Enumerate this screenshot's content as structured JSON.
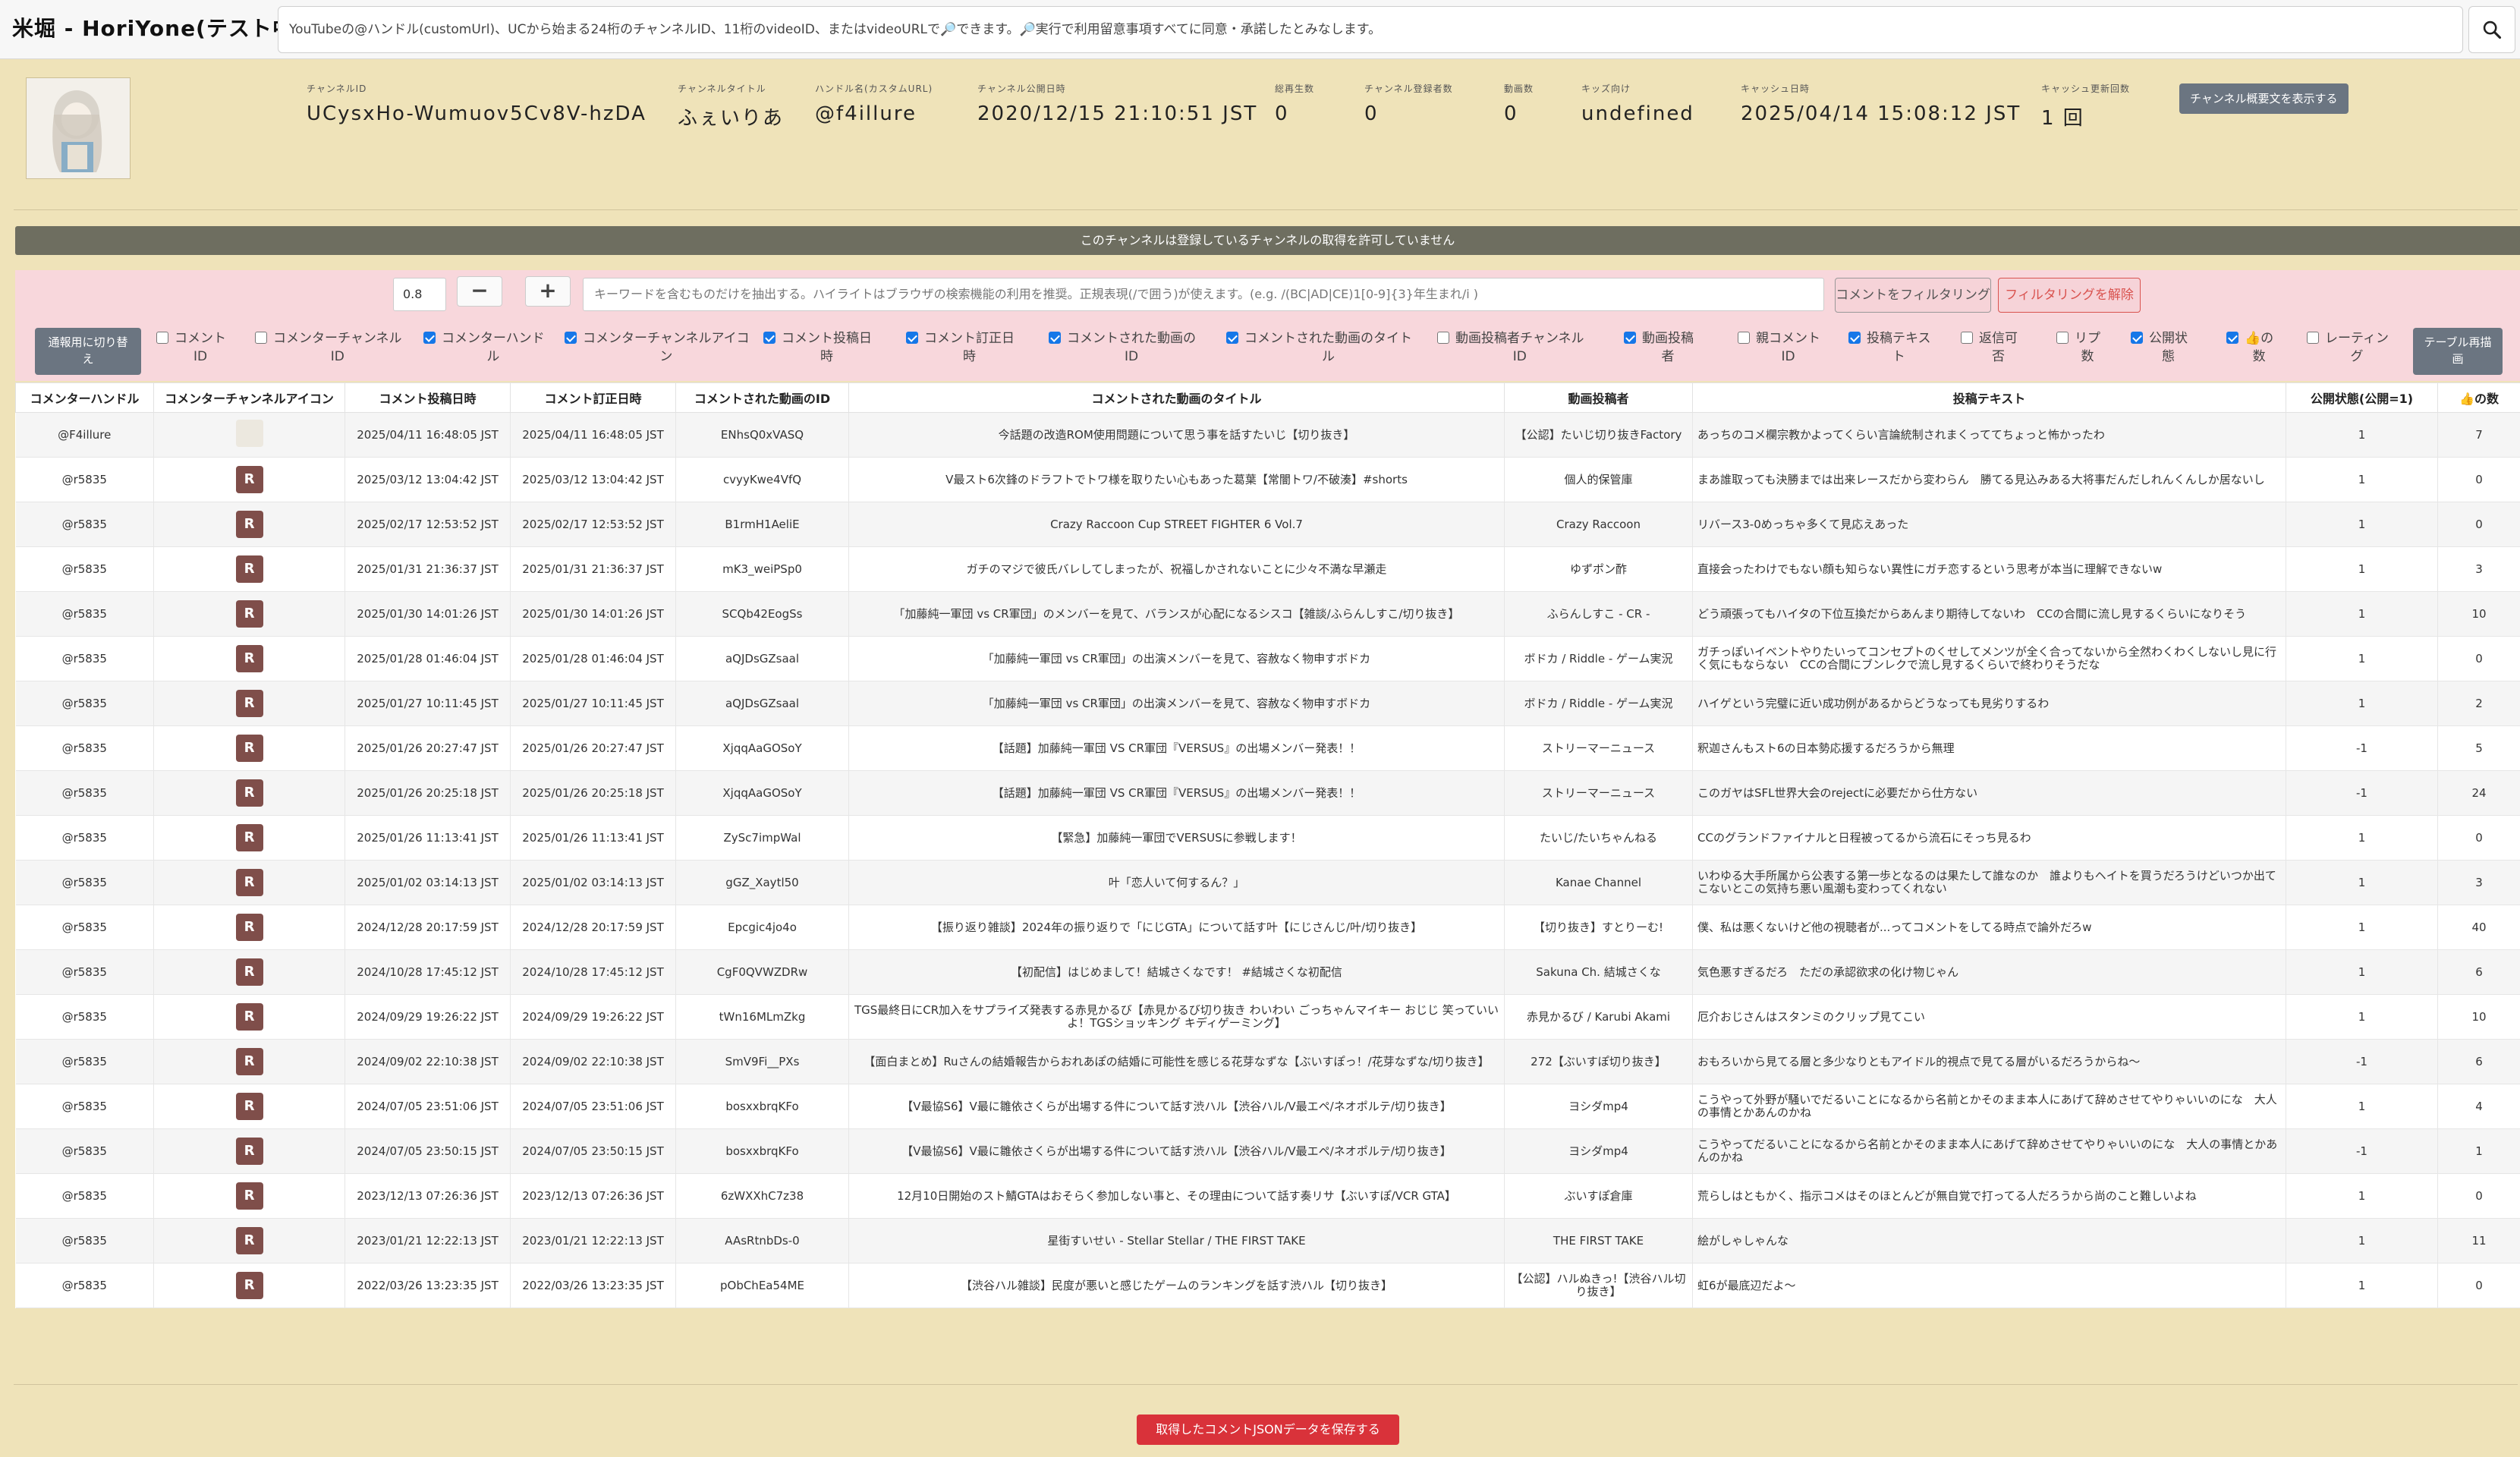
{
  "app_title": "米堀 - HoriYone(テスト中)",
  "search": {
    "placeholder": "YouTubeの@ハンドル(customUrl)、UCから始まる24桁のチャンネルID、11桁のvideoID、またはvideoURLで🔎できます。🔎実行で利用留意事項すべてに同意・承諾したとみなします。"
  },
  "channel": {
    "fields": [
      {
        "label": "チャンネルID",
        "value": "UCysxHo-Wumuov5Cv8V-hzDA"
      },
      {
        "label": "チャンネルタイトル",
        "value": "ふぇいりあ"
      },
      {
        "label": "ハンドル名(カスタムURL)",
        "value": "@f4illure"
      },
      {
        "label": "チャンネル公開日時",
        "value": "2020/12/15 21:10:51 JST"
      },
      {
        "label": "総再生数",
        "value": "0"
      },
      {
        "label": "チャンネル登録者数",
        "value": "0"
      },
      {
        "label": "動画数",
        "value": "0"
      },
      {
        "label": "キッズ向け",
        "value": "undefined"
      },
      {
        "label": "キャッシュ日時",
        "value": "2025/04/14 15:08:12 JST"
      },
      {
        "label": "キャッシュ更新回数",
        "value": "1 回"
      }
    ],
    "desc_button": "チャンネル概要文を表示する"
  },
  "notice": "このチャンネルは登録しているチャンネルの取得を許可していません",
  "filter": {
    "threshold": "0.8",
    "minus": "−",
    "plus": "+",
    "keyword_placeholder": "キーワードを含むものだけを抽出する。ハイライトはブラウザの検索機能の利用を推奨。正規表現(/で囲う)が使えます。(e.g. /(BC|AD|CE)1[0-9]{3}年生まれ/i )",
    "filter_button": "コメントをフィルタリング",
    "clear_button": "フィルタリングを解除",
    "toggle_view_line1": "通報用に切り替",
    "toggle_view_line2": "え",
    "redraw_line1": "テーブル再描",
    "redraw_line2": "画"
  },
  "column_toggles": [
    {
      "l1": "コメント",
      "l2": "ID",
      "checked": false
    },
    {
      "l1": "コメンターチャンネル",
      "l2": "ID",
      "checked": false
    },
    {
      "l1": "コメンターハンド",
      "l2": "ル",
      "checked": true
    },
    {
      "l1": "コメンターチャンネルアイコ",
      "l2": "ン",
      "checked": true
    },
    {
      "l1": "コメント投稿日",
      "l2": "時",
      "checked": true
    },
    {
      "l1": "コメント訂正日",
      "l2": "時",
      "checked": true
    },
    {
      "l1": "コメントされた動画の",
      "l2": "ID",
      "checked": true
    },
    {
      "l1": "コメントされた動画のタイト",
      "l2": "ル",
      "checked": true
    },
    {
      "l1": "動画投稿者チャンネル",
      "l2": "ID",
      "checked": false
    },
    {
      "l1": "動画投稿",
      "l2": "者",
      "checked": true
    },
    {
      "l1": "親コメント",
      "l2": "ID",
      "checked": false
    },
    {
      "l1": "投稿テキス",
      "l2": "ト",
      "checked": true
    },
    {
      "l1": "返信可",
      "l2": "否",
      "checked": false
    },
    {
      "l1": "リプ",
      "l2": "数",
      "checked": false
    },
    {
      "l1": "公開状",
      "l2": "態",
      "checked": true
    },
    {
      "l1": "👍の",
      "l2": "数",
      "checked": true
    },
    {
      "l1": "レーティン",
      "l2": "グ",
      "checked": false
    }
  ],
  "table": {
    "headers": [
      "コメンターハンドル",
      "コメンターチャンネルアイコン",
      "コメント投稿日時",
      "コメント訂正日時",
      "コメントされた動画のID",
      "コメントされた動画のタイトル",
      "動画投稿者",
      "投稿テキスト",
      "公開状態(公開=1)",
      "👍の数"
    ],
    "rows": [
      {
        "handle": "@F4illure",
        "icon": "img",
        "posted": "2025/04/11 16:48:05 JST",
        "edited": "2025/04/11 16:48:05 JST",
        "video_id": "ENhsQ0xVASQ",
        "title": "今話題の改造ROM使用問題について思う事を話すたいじ【切り抜き】",
        "uploader": "【公認】たいじ切り抜きFactory",
        "text": "あっちのコメ欄宗教かよってくらい言論統制されまくっててちょっと怖かったわ",
        "status": "1",
        "likes": "7"
      },
      {
        "handle": "@r5835",
        "icon": "R",
        "posted": "2025/03/12 13:04:42 JST",
        "edited": "2025/03/12 13:04:42 JST",
        "video_id": "cvyyKwe4VfQ",
        "title": "V最スト6次鋒のドラフトでトワ様を取りたい心もあった葛葉【常闇トワ/不破湊】#shorts",
        "uploader": "個人的保管庫",
        "text": "まあ誰取っても決勝までは出来レースだから変わらん　勝てる見込みある大将事だんだしれんくんしか居ないし",
        "status": "1",
        "likes": "0"
      },
      {
        "handle": "@r5835",
        "icon": "R",
        "posted": "2025/02/17 12:53:52 JST",
        "edited": "2025/02/17 12:53:52 JST",
        "video_id": "B1rmH1AeliE",
        "title": "Crazy Raccoon Cup STREET FIGHTER 6 Vol.7",
        "uploader": "Crazy Raccoon",
        "text": "リバース3-0めっちゃ多くて見応えあった",
        "status": "1",
        "likes": "0"
      },
      {
        "handle": "@r5835",
        "icon": "R",
        "posted": "2025/01/31 21:36:37 JST",
        "edited": "2025/01/31 21:36:37 JST",
        "video_id": "mK3_weiPSp0",
        "title": "ガチのマジで彼氏バレしてしまったが、祝福しかされないことに少々不満な早瀬走",
        "uploader": "ゆずポン酢",
        "text": "直接会ったわけでもない顔も知らない異性にガチ恋するという思考が本当に理解できないw",
        "status": "1",
        "likes": "3"
      },
      {
        "handle": "@r5835",
        "icon": "R",
        "posted": "2025/01/30 14:01:26 JST",
        "edited": "2025/01/30 14:01:26 JST",
        "video_id": "SCQb42EogSs",
        "title": "「加藤純一軍団 vs CR軍団」のメンバーを見て、バランスが心配になるシスコ【雑談/ふらんしすこ/切り抜き】",
        "uploader": "ふらんしすこ - CR -",
        "text": "どう頑張ってもハイタの下位互換だからあんまり期待してないわ　CCの合間に流し見するくらいになりそう",
        "status": "1",
        "likes": "10"
      },
      {
        "handle": "@r5835",
        "icon": "R",
        "posted": "2025/01/28 01:46:04 JST",
        "edited": "2025/01/28 01:46:04 JST",
        "video_id": "aQJDsGZsaal",
        "title": "「加藤純一軍団 vs CR軍団」の出演メンバーを見て、容赦なく物申すボドカ",
        "uploader": "ボドカ / Riddle - ゲーム実況",
        "text": "ガチっぽいイベントやりたいってコンセプトのくせしてメンツが全く合ってないから全然わくわくしないし見に行く気にもならない　CCの合間にブンレクで流し見するくらいで終わりそうだな",
        "status": "1",
        "likes": "0"
      },
      {
        "handle": "@r5835",
        "icon": "R",
        "posted": "2025/01/27 10:11:45 JST",
        "edited": "2025/01/27 10:11:45 JST",
        "video_id": "aQJDsGZsaal",
        "title": "「加藤純一軍団 vs CR軍団」の出演メンバーを見て、容赦なく物申すボドカ",
        "uploader": "ボドカ / Riddle - ゲーム実況",
        "text": "ハイゲという完璧に近い成功例があるからどうなっても見劣りするわ",
        "status": "1",
        "likes": "2"
      },
      {
        "handle": "@r5835",
        "icon": "R",
        "posted": "2025/01/26 20:27:47 JST",
        "edited": "2025/01/26 20:27:47 JST",
        "video_id": "XjqqAaGOSoY",
        "title": "【話題】加藤純一軍団 VS CR軍団『VERSUS』の出場メンバー発表！！",
        "uploader": "ストリーマーニュース",
        "text": "釈迦さんもスト6の日本勢応援するだろうから無理",
        "status": "-1",
        "likes": "5"
      },
      {
        "handle": "@r5835",
        "icon": "R",
        "posted": "2025/01/26 20:25:18 JST",
        "edited": "2025/01/26 20:25:18 JST",
        "video_id": "XjqqAaGOSoY",
        "title": "【話題】加藤純一軍団 VS CR軍団『VERSUS』の出場メンバー発表！！",
        "uploader": "ストリーマーニュース",
        "text": "このガヤはSFL世界大会のrejectに必要だから仕方ない",
        "status": "-1",
        "likes": "24"
      },
      {
        "handle": "@r5835",
        "icon": "R",
        "posted": "2025/01/26 11:13:41 JST",
        "edited": "2025/01/26 11:13:41 JST",
        "video_id": "ZySc7impWal",
        "title": "【緊急】加藤純一軍団でVERSUSに参戦します！",
        "uploader": "たいじ/たいちゃんねる",
        "text": "CCのグランドファイナルと日程被ってるから流石にそっち見るわ",
        "status": "1",
        "likes": "0"
      },
      {
        "handle": "@r5835",
        "icon": "R",
        "posted": "2025/01/02 03:14:13 JST",
        "edited": "2025/01/02 03:14:13 JST",
        "video_id": "gGZ_Xaytl50",
        "title": "叶「恋人いて何するん？」",
        "uploader": "Kanae Channel",
        "text": "いわゆる大手所属から公表する第一歩となるのは果たして誰なのか　誰よりもヘイトを買うだろうけどいつか出てこないとこの気持ち悪い風潮も変わってくれない",
        "status": "1",
        "likes": "3"
      },
      {
        "handle": "@r5835",
        "icon": "R",
        "posted": "2024/12/28 20:17:59 JST",
        "edited": "2024/12/28 20:17:59 JST",
        "video_id": "Epcgic4jo4o",
        "title": "【振り返り雑談】2024年の振り返りで「にじGTA」について話す叶【にじさんじ/叶/切り抜き】",
        "uploader": "【切り抜き】すとりーむ!",
        "text": "僕、私は悪くないけど他の視聴者が...ってコメントをしてる時点で論外だろw",
        "status": "1",
        "likes": "40"
      },
      {
        "handle": "@r5835",
        "icon": "R",
        "posted": "2024/10/28 17:45:12 JST",
        "edited": "2024/10/28 17:45:12 JST",
        "video_id": "CgF0QVWZDRw",
        "title": "【初配信】はじめまして！結城さくなです！ #結城さくな初配信",
        "uploader": "Sakuna Ch. 結城さくな",
        "text": "気色悪すぎるだろ　ただの承認欲求の化け物じゃん",
        "status": "1",
        "likes": "6"
      },
      {
        "handle": "@r5835",
        "icon": "R",
        "posted": "2024/09/29 19:26:22 JST",
        "edited": "2024/09/29 19:26:22 JST",
        "video_id": "tWn16MLmZkg",
        "title": "TGS最終日にCR加入をサプライズ発表する赤見かるび【赤見かるび切り抜き わいわい ごっちゃんマイキー おじじ 笑っていいよ！TGSショッキング キディゲーミング】",
        "uploader": "赤見かるび / Karubi Akami",
        "text": "厄介おじさんはスタンミのクリップ見てこい",
        "status": "1",
        "likes": "10"
      },
      {
        "handle": "@r5835",
        "icon": "R",
        "posted": "2024/09/02 22:10:38 JST",
        "edited": "2024/09/02 22:10:38 JST",
        "video_id": "SmV9Fi__PXs",
        "title": "【面白まとめ】Ruさんの結婚報告からおれあぽの結婚に可能性を感じる花芽なずな【ぶいすぽっ！/花芽なずな/切り抜き】",
        "uploader": "272【ぶいすぽ切り抜き】",
        "text": "おもろいから見てる層と多少なりともアイドル的視点で見てる層がいるだろうからね〜",
        "status": "-1",
        "likes": "6"
      },
      {
        "handle": "@r5835",
        "icon": "R",
        "posted": "2024/07/05 23:51:06 JST",
        "edited": "2024/07/05 23:51:06 JST",
        "video_id": "bosxxbrqKFo",
        "title": "【V最協S6】V最に雛依さくらが出場する件について話す渋ハル【渋谷ハル/V最エペ/ネオポルテ/切り抜き】",
        "uploader": "ヨシダmp4",
        "text": "こうやって外野が騒いでだるいことになるから名前とかそのまま本人にあげて辞めさせてやりゃいいのにな　大人の事情とかあんのかね",
        "status": "1",
        "likes": "4"
      },
      {
        "handle": "@r5835",
        "icon": "R",
        "posted": "2024/07/05 23:50:15 JST",
        "edited": "2024/07/05 23:50:15 JST",
        "video_id": "bosxxbrqKFo",
        "title": "【V最協S6】V最に雛依さくらが出場する件について話す渋ハル【渋谷ハル/V最エペ/ネオポルテ/切り抜き】",
        "uploader": "ヨシダmp4",
        "text": "こうやってだるいことになるから名前とかそのまま本人にあげて辞めさせてやりゃいいのにな　大人の事情とかあんのかね",
        "status": "-1",
        "likes": "1"
      },
      {
        "handle": "@r5835",
        "icon": "R",
        "posted": "2023/12/13 07:26:36 JST",
        "edited": "2023/12/13 07:26:36 JST",
        "video_id": "6zWXXhC7z38",
        "title": "12月10日開始のスト鯖GTAはおそらく参加しない事と、その理由について話す奏リサ【ぶいすぽ/VCR GTA】",
        "uploader": "ぶいすぽ倉庫",
        "text": "荒らしはともかく、指示コメはそのほとんどが無自覚で打ってる人だろうから尚のこと難しいよね",
        "status": "1",
        "likes": "0"
      },
      {
        "handle": "@r5835",
        "icon": "R",
        "posted": "2023/01/21 12:22:13 JST",
        "edited": "2023/01/21 12:22:13 JST",
        "video_id": "AAsRtnbDs-0",
        "title": "星街すいせい - Stellar Stellar / THE FIRST TAKE",
        "uploader": "THE FIRST TAKE",
        "text": "絵がしゃしゃんな",
        "status": "1",
        "likes": "11"
      },
      {
        "handle": "@r5835",
        "icon": "R",
        "posted": "2022/03/26 13:23:35 JST",
        "edited": "2022/03/26 13:23:35 JST",
        "video_id": "pObChEa54ME",
        "title": "【渋谷ハル雑談】民度が悪いと感じたゲームのランキングを話す渋ハル【切り抜き】",
        "uploader": "【公認】ハルぬきっ!【渋谷ハル切り抜き】",
        "text": "虹6が最底辺だよ〜",
        "status": "1",
        "likes": "0"
      }
    ]
  },
  "save_button": "取得したコメントJSONデータを保存する"
}
